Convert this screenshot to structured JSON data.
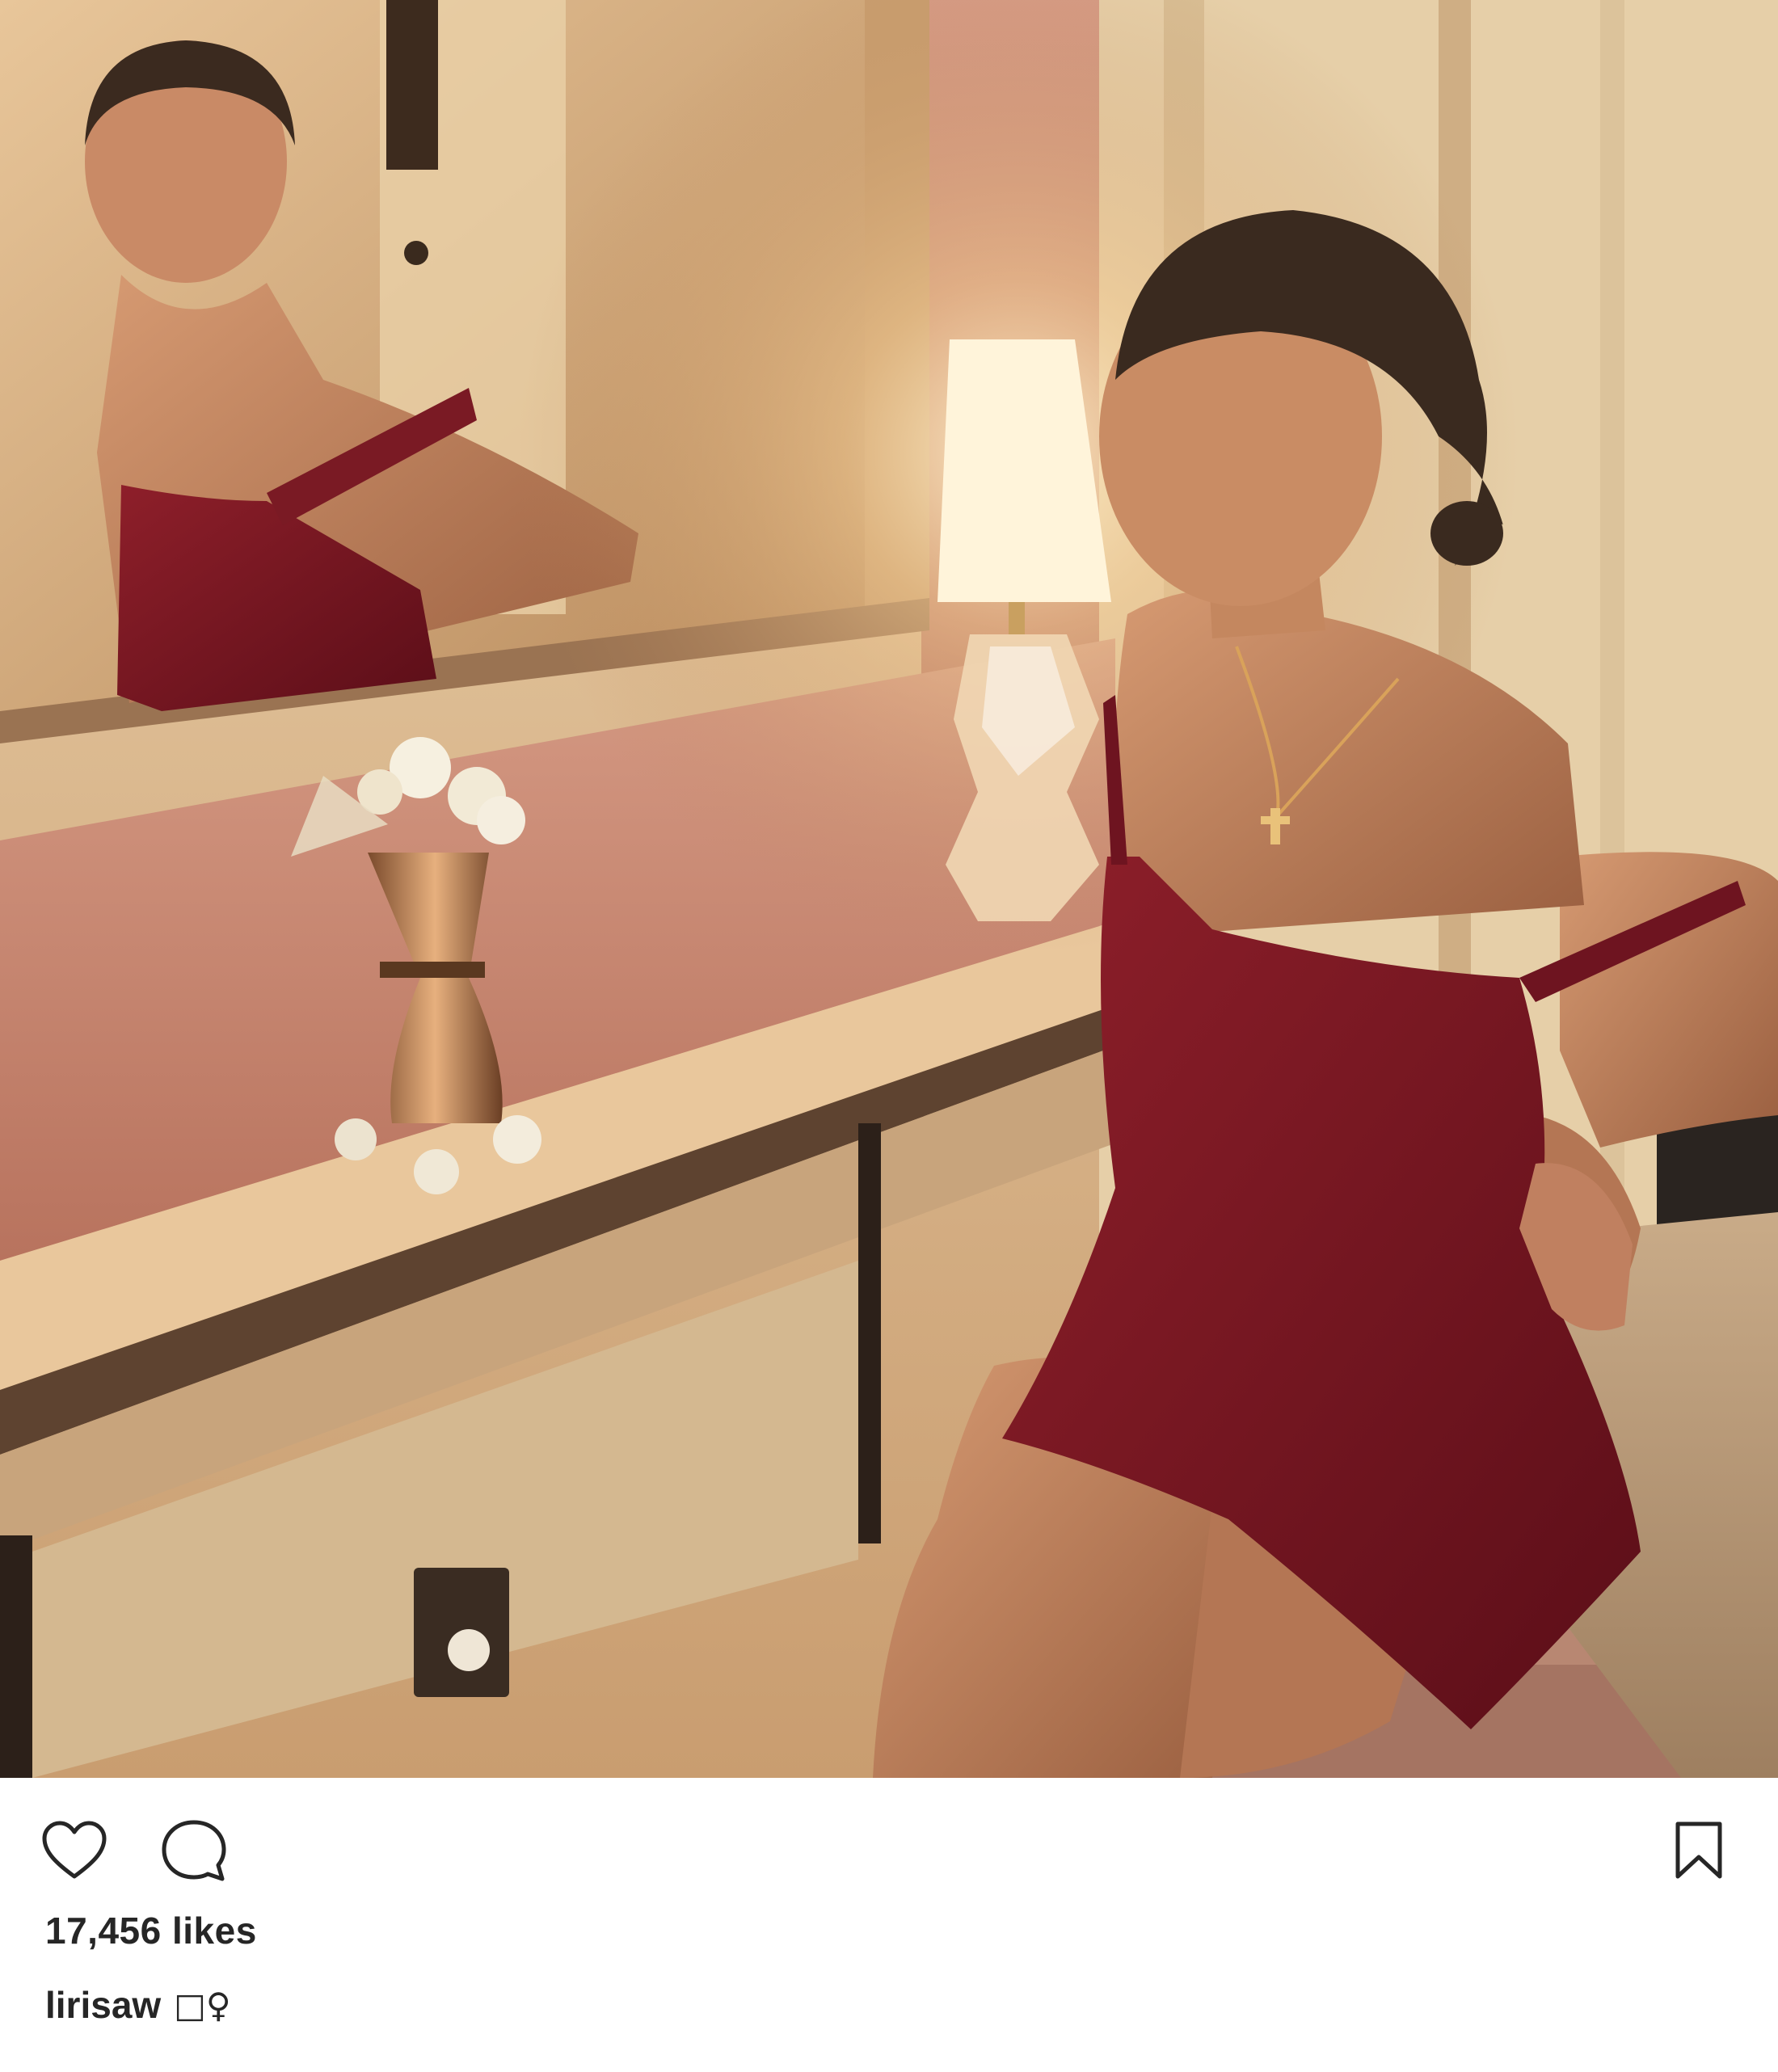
{
  "post": {
    "image_alt": "Woman in a burgundy slip dress seated at a mirrored vanity with a lamp and flowers",
    "likes_text": "17,456 likes",
    "caption": {
      "username": "lirisaw",
      "glyphs": "□♀"
    },
    "comments_peek": "· · · · · · · · ·"
  },
  "actions": {
    "like_icon": "heart-outline-icon",
    "comment_icon": "speech-bubble-icon",
    "save_icon": "bookmark-outline-icon"
  },
  "colors": {
    "text": "#262626",
    "muted": "#999999",
    "background": "#ffffff",
    "icon_stroke": "#262626"
  }
}
